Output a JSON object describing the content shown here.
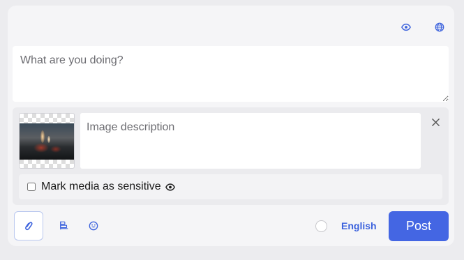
{
  "composer": {
    "placeholder": "What are you doing?",
    "top_icons": [
      "eye-icon",
      "globe-icon"
    ]
  },
  "media": {
    "description_placeholder": "Image description",
    "sensitive_label": "Mark media as sensitive",
    "sensitive_checked": false
  },
  "toolbar": {
    "tools": [
      "paperclip-icon",
      "poll-icon",
      "emoji-icon"
    ],
    "language": "English",
    "post_label": "Post"
  },
  "colors": {
    "accent": "#3d63dd",
    "post_button": "#4466e3",
    "background": "#ececef",
    "panel": "#f5f5f7"
  }
}
